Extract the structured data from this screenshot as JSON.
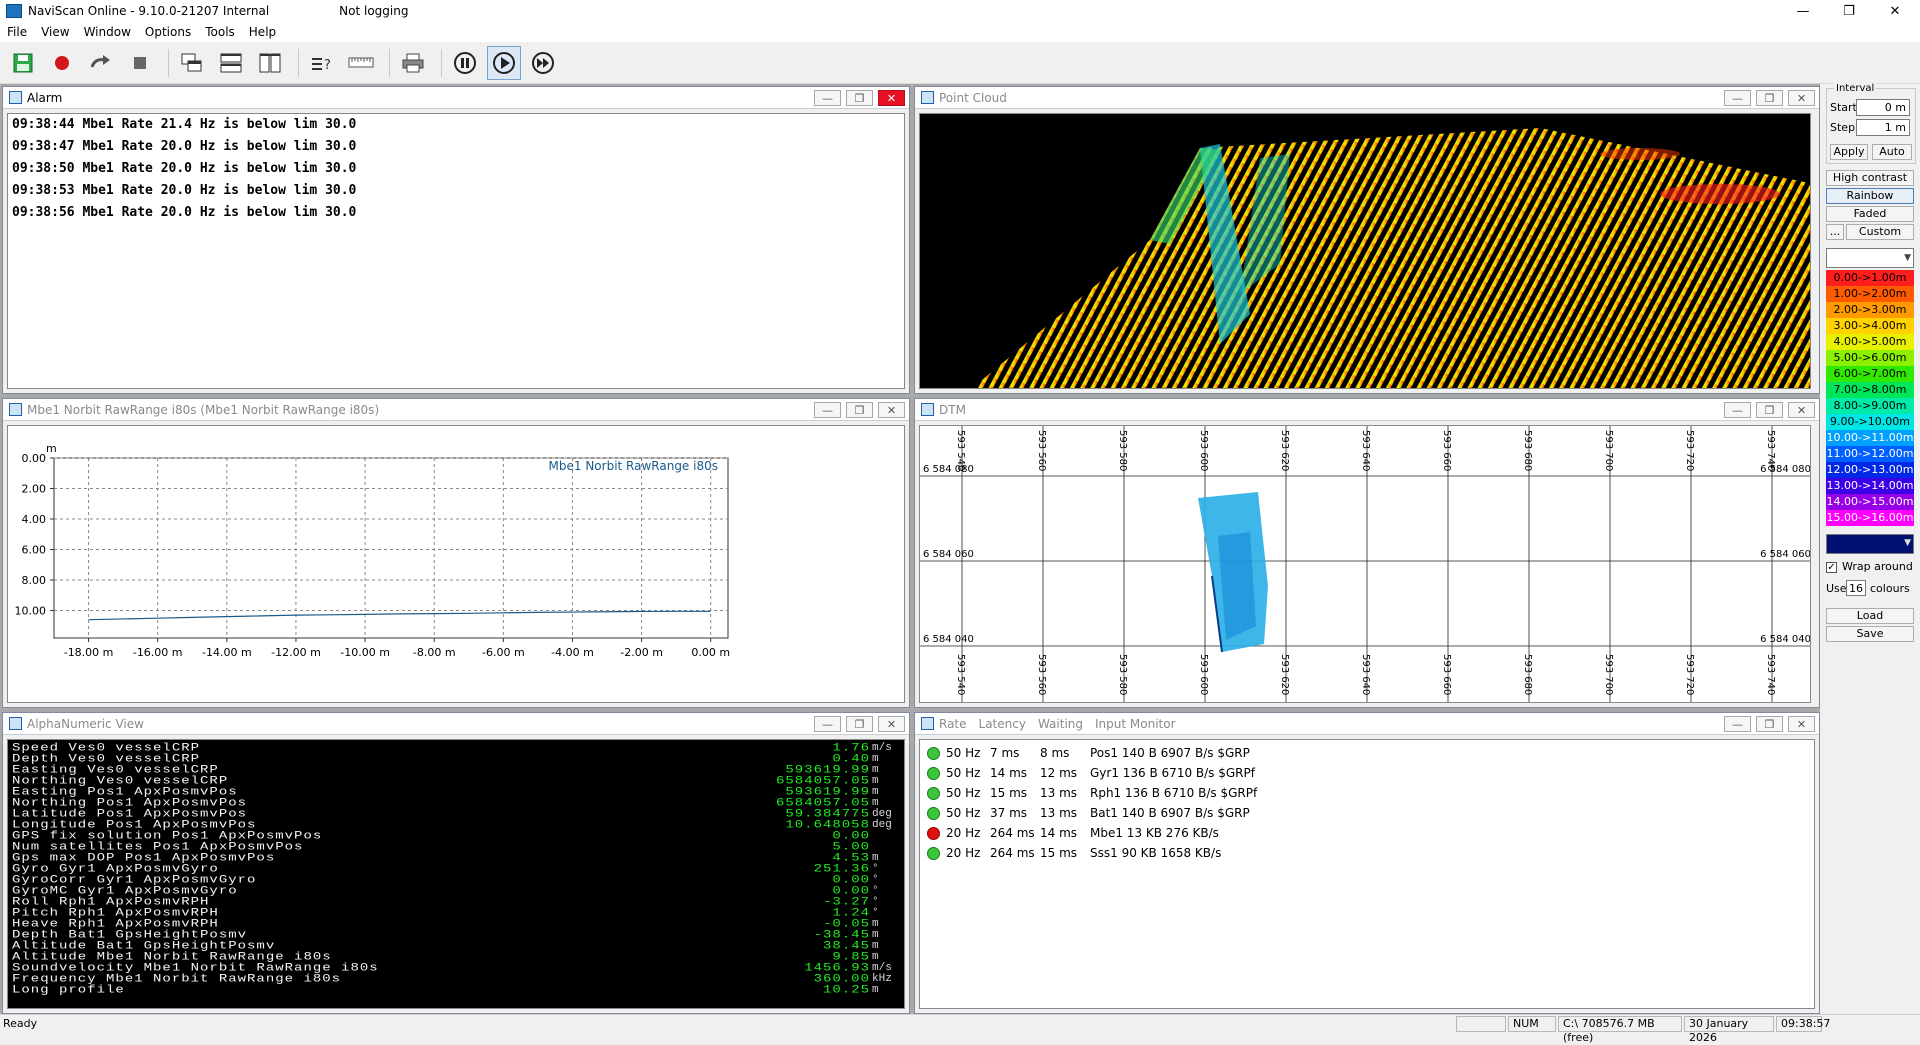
{
  "app": {
    "title": "NaviScan Online - 9.10.0-21207 Internal",
    "logging_status": "Not logging"
  },
  "menu": [
    "File",
    "View",
    "Window",
    "Options",
    "Tools",
    "Help"
  ],
  "toolbar": {
    "icons": [
      "save-icon",
      "record-icon",
      "redo-icon",
      "stop-icon",
      "cascade-icon",
      "tile-horizontal-icon",
      "tile-vertical-icon",
      "query-icon",
      "ruler-icon",
      "print-icon",
      "pause-icon",
      "play-icon",
      "fast-forward-icon"
    ],
    "active": "play-icon"
  },
  "alarm_window": {
    "title": "Alarm",
    "lines": [
      "09:38:44 Mbe1 Rate 21.4 Hz is below lim 30.0",
      "09:38:47 Mbe1 Rate 20.0 Hz is below lim 30.0",
      "09:38:50 Mbe1 Rate 20.0 Hz is below lim 30.0",
      "09:38:53 Mbe1 Rate 20.0 Hz is below lim 30.0",
      "09:38:56 Mbe1 Rate 20.0 Hz is below lim 30.0"
    ]
  },
  "pointcloud_window": {
    "title": "Point Cloud"
  },
  "chart_window": {
    "title": "Mbe1 Norbit RawRange i80s (Mbe1 Norbit RawRange i80s)"
  },
  "chart_data": {
    "type": "line",
    "title": "",
    "xlabel": "",
    "ylabel": "m",
    "legend_position": "top-right",
    "series": [
      {
        "name": "Mbe1 Norbit RawRange i80s",
        "x": [
          -18,
          -17,
          -16,
          -15,
          -14,
          -13,
          -12,
          -11,
          -10,
          -9,
          -8,
          -7,
          -6,
          -5,
          -4,
          -3,
          -2,
          -1,
          0
        ],
        "y": [
          10.6,
          10.55,
          10.5,
          10.45,
          10.4,
          10.35,
          10.3,
          10.28,
          10.25,
          10.22,
          10.2,
          10.18,
          10.15,
          10.12,
          10.1,
          10.08,
          10.06,
          10.05,
          10.05
        ]
      }
    ],
    "xlim": [
      -19,
      0.5
    ],
    "ylim": [
      0,
      11.8
    ],
    "y_inverted": true,
    "xticks": [
      -18,
      -16,
      -14,
      -12,
      -10,
      -8,
      -6,
      -4,
      -2,
      0
    ],
    "xtick_labels": [
      "-18.00 m",
      "-16.00 m",
      "-14.00 m",
      "-12.00 m",
      "-10.00 m",
      "-8.00 m",
      "-6.00 m",
      "-4.00 m",
      "-2.00 m",
      "0.00 m"
    ],
    "yticks": [
      0,
      2,
      4,
      6,
      8,
      10
    ],
    "ytick_labels": [
      "0.00",
      "2.00",
      "4.00",
      "6.00",
      "8.00",
      "10.00"
    ],
    "grid": true
  },
  "dtm_window": {
    "title": "DTM",
    "eastings": [
      "593 540",
      "593 560",
      "593 580",
      "593 600",
      "593 620",
      "593 640",
      "593 660",
      "593 680",
      "593 700",
      "593 720",
      "593 740"
    ],
    "northings": [
      "6 584 080",
      "6 584 060",
      "6 584 040"
    ]
  },
  "alphanumeric_window": {
    "title": "AlphaNumeric View",
    "rows": [
      {
        "label": "Speed Ves0 vesselCRP",
        "value": "1.76",
        "unit": "m/s"
      },
      {
        "label": "Depth Ves0 vesselCRP",
        "value": "0.40",
        "unit": "m"
      },
      {
        "label": "Easting Ves0 vesselCRP",
        "value": "593619.99",
        "unit": "m"
      },
      {
        "label": "Northing Ves0 vesselCRP",
        "value": "6584057.05",
        "unit": "m"
      },
      {
        "label": "Easting Pos1 ApxPosmvPos",
        "value": "593619.99",
        "unit": "m"
      },
      {
        "label": "Northing Pos1 ApxPosmvPos",
        "value": "6584057.05",
        "unit": "m"
      },
      {
        "label": "Latitude Pos1 ApxPosmvPos",
        "value": "59.384775",
        "unit": "deg"
      },
      {
        "label": "Longitude Pos1 ApxPosmvPos",
        "value": "10.648058",
        "unit": "deg"
      },
      {
        "label": "GPS fix solution Pos1 ApxPosmvPos",
        "value": "0.00",
        "unit": ""
      },
      {
        "label": "Num satellites Pos1 ApxPosmvPos",
        "value": "5.00",
        "unit": ""
      },
      {
        "label": "Gps max DOP Pos1 ApxPosmvPos",
        "value": "4.53",
        "unit": "m"
      },
      {
        "label": "Gyro Gyr1 ApxPosmvGyro",
        "value": "251.36",
        "unit": "°"
      },
      {
        "label": "GyroCorr Gyr1 ApxPosmvGyro",
        "value": "0.00",
        "unit": "°"
      },
      {
        "label": "GyroMC Gyr1 ApxPosmvGyro",
        "value": "0.00",
        "unit": "°"
      },
      {
        "label": "Roll Rph1 ApxPosmvRPH",
        "value": "-3.27",
        "unit": "°"
      },
      {
        "label": "Pitch Rph1 ApxPosmvRPH",
        "value": "1.24",
        "unit": "°"
      },
      {
        "label": "Heave Rph1 ApxPosmvRPH",
        "value": "-0.05",
        "unit": "m"
      },
      {
        "label": "Depth Bat1 GpsHeightPosmv",
        "value": "-38.45",
        "unit": "m"
      },
      {
        "label": "Altitude Bat1 GpsHeightPosmv",
        "value": "38.45",
        "unit": "m"
      },
      {
        "label": "Altitude Mbe1 Norbit RawRange i80s",
        "value": "9.85",
        "unit": "m"
      },
      {
        "label": "Soundvelocity Mbe1 Norbit RawRange i80s",
        "value": "1456.93",
        "unit": "m/s"
      },
      {
        "label": "Frequency Mbe1 Norbit RawRange i80s",
        "value": "360.00",
        "unit": "kHz"
      },
      {
        "label": "Long profile",
        "value": "10.25",
        "unit": "m"
      }
    ]
  },
  "status_window": {
    "title_parts": [
      "Rate",
      "Latency",
      "Waiting",
      "Input Monitor"
    ],
    "rows": [
      {
        "status": "green",
        "rate": "50 Hz",
        "latency": "7 ms",
        "waiting": "8 ms",
        "monitor": "Pos1  140 B 6907 B/s $GRP"
      },
      {
        "status": "green",
        "rate": "50 Hz",
        "latency": "14 ms",
        "waiting": "12 ms",
        "monitor": "Gyr1  136 B 6710 B/s $GRPf"
      },
      {
        "status": "green",
        "rate": "50 Hz",
        "latency": "15 ms",
        "waiting": "13 ms",
        "monitor": "Rph1  136 B 6710 B/s $GRPf"
      },
      {
        "status": "green",
        "rate": "50 Hz",
        "latency": "37 ms",
        "waiting": "13 ms",
        "monitor": "Bat1  140 B 6907 B/s $GRP"
      },
      {
        "status": "red",
        "rate": "20 Hz",
        "latency": "264 ms",
        "waiting": "14 ms",
        "monitor": "Mbe1  13 KB 276 KB/s"
      },
      {
        "status": "green",
        "rate": "20 Hz",
        "latency": "264 ms",
        "waiting": "15 ms",
        "monitor": "Sss1  90 KB 1658 KB/s"
      }
    ]
  },
  "right_panel": {
    "interval_label": "Interval",
    "start_label": "Start",
    "start_value": "0 m",
    "step_label": "Step",
    "step_value": "1 m",
    "apply_label": "Apply",
    "auto_label": "Auto",
    "high_contrast_label": "High contrast",
    "rainbow_label": "Rainbow",
    "faded_label": "Faded",
    "ellipsis_label": "...",
    "custom_label": "Custom",
    "legend": [
      {
        "label": "0.00->1.00m",
        "color": "#ff1e1e"
      },
      {
        "label": "1.00->2.00m",
        "color": "#ff5a00"
      },
      {
        "label": "2.00->3.00m",
        "color": "#ff9a00"
      },
      {
        "label": "3.00->4.00m",
        "color": "#ffd200"
      },
      {
        "label": "4.00->5.00m",
        "color": "#e6f000"
      },
      {
        "label": "5.00->6.00m",
        "color": "#8cf000"
      },
      {
        "label": "6.00->7.00m",
        "color": "#30e800"
      },
      {
        "label": "7.00->8.00m",
        "color": "#00e65a"
      },
      {
        "label": "8.00->9.00m",
        "color": "#00ebaa"
      },
      {
        "label": "9.00->10.00m",
        "color": "#00e6e6"
      },
      {
        "label": "10.00->11.00m",
        "color": "#00a0ff"
      },
      {
        "label": "11.00->12.00m",
        "color": "#0060ff"
      },
      {
        "label": "12.00->13.00m",
        "color": "#0028e6"
      },
      {
        "label": "13.00->14.00m",
        "color": "#3c00e6"
      },
      {
        "label": "14.00->15.00m",
        "color": "#9600e6"
      },
      {
        "label": "15.00->16.00m",
        "color": "#ff00ff"
      }
    ],
    "swatch_color": "#001070",
    "wrap_label": "Wrap around",
    "use_label": "Use",
    "use_value": "16",
    "colours_label": "colours",
    "load_label": "Load",
    "save_label": "Save"
  },
  "statusbar": {
    "ready": "Ready",
    "num": "NUM",
    "disk": "C:\\ 708576.7 MB (free)",
    "date": "30 January 2026",
    "time": "09:38:57"
  }
}
